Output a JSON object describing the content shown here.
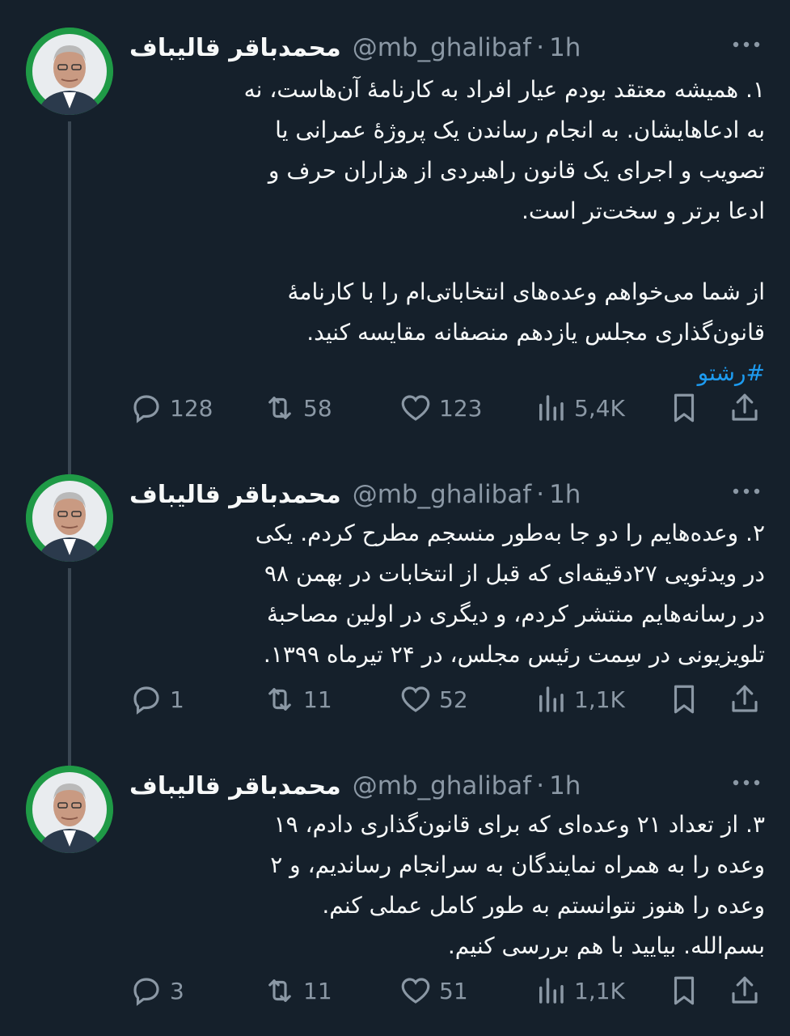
{
  "tweets": [
    {
      "name": "محمدباقر قالیباف",
      "handle": "@mb_ghalibaf",
      "separator": "·",
      "time": "1h",
      "body": "۱. همیشه معتقد بودم عیار افراد به کارنامهٔ آن‌هاست، نه\nبه ادعاهایشان. به انجام رساندن یک پروژهٔ عمرانی یا\nتصویب و اجرای یک قانون راهبردی از هزاران حرف و\nادعا برتر و سخت‌تر است.\n\nاز شما می‌خواهم وعده‌های انتخاباتی‌ام را با کارنامهٔ\nقانون‌گذاری مجلس یازدهم منصفانه مقایسه کنید.",
      "hashtag": "#رشتو",
      "replies": "128",
      "retweets": "58",
      "likes": "123",
      "views": "5,4K"
    },
    {
      "name": "محمدباقر قالیباف",
      "handle": "@mb_ghalibaf",
      "separator": "·",
      "time": "1h",
      "body": "۲. وعده‌هایم را دو جا به‌طور منسجم مطرح کردم. یکی\nدر ویدئویی ۲۷دقیقه‌ای که قبل از انتخابات در بهمن ۹۸\nدر رسانه‌هایم منتشر کردم، و دیگری در اولین مصاحبهٔ\nتلویزیونی در سِمت رئیس مجلس، در ۲۴ تیرماه ۱۳۹۹.",
      "hashtag": "",
      "replies": "1",
      "retweets": "11",
      "likes": "52",
      "views": "1,1K"
    },
    {
      "name": "محمدباقر قالیباف",
      "handle": "@mb_ghalibaf",
      "separator": "·",
      "time": "1h",
      "body": "۳. از تعداد ۲۱ وعده‌ای که برای قانون‌گذاری دادم، ۱۹\nوعده را به همراه نمایندگان به سرانجام رساندیم، و ۲\nوعده را هنوز نتوانستم به طور کامل عملی کنم.\nبسم‌الله. بیایید با هم بررسی کنیم.",
      "hashtag": "",
      "replies": "3",
      "retweets": "11",
      "likes": "51",
      "views": "1,1K"
    }
  ],
  "colors": {
    "background": "#15202b",
    "text": "#f7f9f9",
    "muted": "#8b98a5",
    "accent": "#1d9bf0",
    "thread_line": "#3a4753"
  },
  "icons": [
    "more-icon",
    "reply-icon",
    "retweet-icon",
    "like-icon",
    "views-icon",
    "bookmark-icon",
    "share-icon",
    "avatar"
  ]
}
